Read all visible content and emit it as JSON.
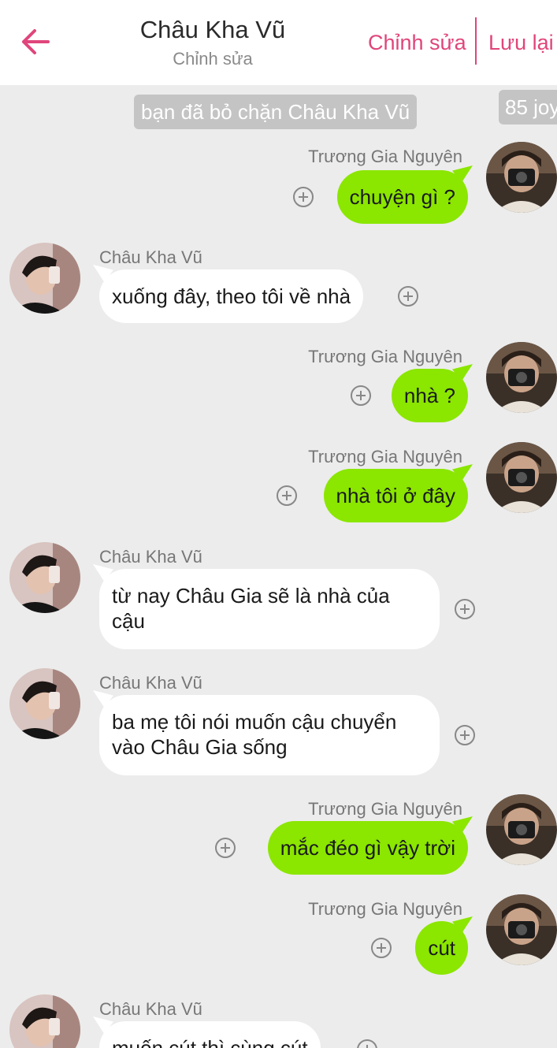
{
  "header": {
    "title": "Châu Kha Vũ",
    "subtitle": "Chỉnh sửa",
    "edit_label": "Chỉnh sửa",
    "save_label": "Lưu lại",
    "accent_color": "#e0457b",
    "back_icon": "arrow-left-icon"
  },
  "chat": {
    "notice": "bạn đã bỏ chặn Châu Kha Vũ",
    "watermark": "85 joy",
    "bubble_colors": {
      "outgoing": "#8be600",
      "incoming": "#ffffff"
    },
    "messages": [
      {
        "side": "right",
        "sender": "Trương Gia Nguyên",
        "text": "chuyện gì ?"
      },
      {
        "side": "left",
        "sender": "Châu Kha Vũ",
        "text": "xuống đây, theo tôi về nhà"
      },
      {
        "side": "right",
        "sender": "Trương Gia Nguyên",
        "text": "nhà ?"
      },
      {
        "side": "right",
        "sender": "Trương Gia Nguyên",
        "text": "nhà tôi ở đây"
      },
      {
        "side": "left",
        "sender": "Châu Kha Vũ",
        "text": "từ nay Châu Gia sẽ là nhà của cậu"
      },
      {
        "side": "left",
        "sender": "Châu Kha Vũ",
        "text": "ba mẹ tôi nói muốn cậu chuyển vào Châu Gia sống"
      },
      {
        "side": "right",
        "sender": "Trương Gia Nguyên",
        "text": "mắc đéo gì vậy trời"
      },
      {
        "side": "right",
        "sender": "Trương Gia Nguyên",
        "text": "cút"
      },
      {
        "side": "left",
        "sender": "Châu Kha Vũ",
        "text": "muốn cút thì cùng cút"
      }
    ]
  }
}
